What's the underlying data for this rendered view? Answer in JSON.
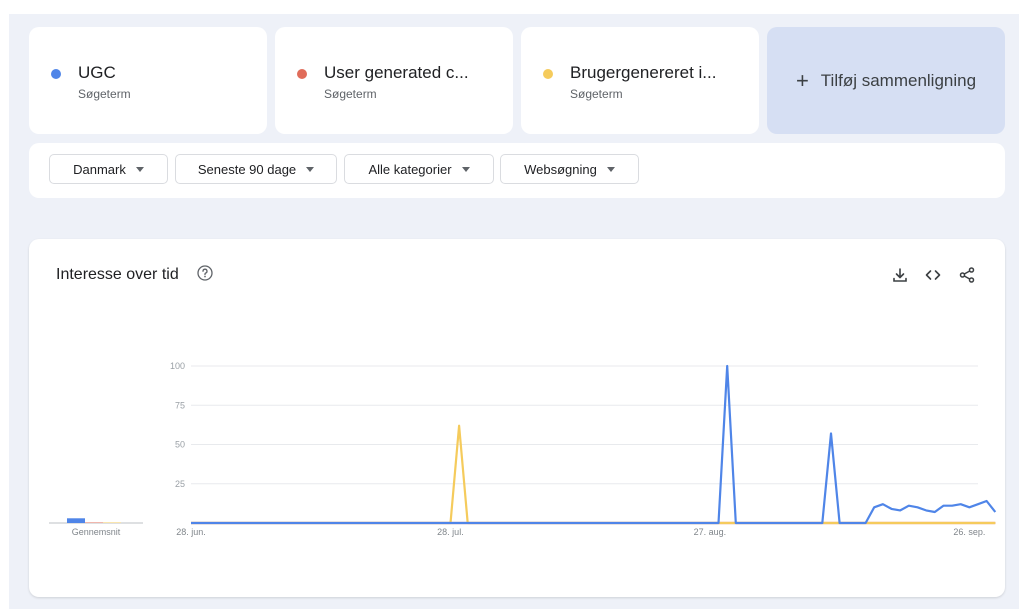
{
  "terms": [
    {
      "name": "UGC",
      "type": "Søgeterm",
      "color": "#4f85e8"
    },
    {
      "name": "User generated c...",
      "type": "Søgeterm",
      "color": "#e06c5a"
    },
    {
      "name": "Brugergenereret i...",
      "type": "Søgeterm",
      "color": "#f5cb5c"
    }
  ],
  "add_compare": {
    "label": "Tilføj sammenligning",
    "icon": "plus-icon"
  },
  "filters": [
    {
      "label": "Danmark"
    },
    {
      "label": "Seneste 90 dage"
    },
    {
      "label": "Alle kategorier"
    },
    {
      "label": "Websøgning"
    }
  ],
  "chart_card": {
    "title": "Interesse over tid",
    "icons": [
      "help-icon",
      "download-icon",
      "embed-icon",
      "share-icon"
    ]
  },
  "chart_data": {
    "type": "line",
    "title": "Interesse over tid",
    "xlabel": "",
    "ylabel": "",
    "ylim": [
      0,
      100
    ],
    "yticks": [
      25,
      50,
      75,
      100
    ],
    "x_tick_labels": [
      {
        "index": 0,
        "label": "28. jun."
      },
      {
        "index": 30,
        "label": "28. jul."
      },
      {
        "index": 60,
        "label": "27. aug."
      },
      {
        "index": 90,
        "label": "26. sep."
      }
    ],
    "num_points": 92,
    "series": [
      {
        "name": "UGC",
        "color": "#4f85e8",
        "average": 3,
        "values": [
          0,
          0,
          0,
          0,
          0,
          0,
          0,
          0,
          0,
          0,
          0,
          0,
          0,
          0,
          0,
          0,
          0,
          0,
          0,
          0,
          0,
          0,
          0,
          0,
          0,
          0,
          0,
          0,
          0,
          0,
          0,
          0,
          0,
          0,
          0,
          0,
          0,
          0,
          0,
          0,
          0,
          0,
          0,
          0,
          0,
          0,
          0,
          0,
          0,
          0,
          0,
          0,
          0,
          0,
          0,
          0,
          0,
          0,
          0,
          0,
          0,
          0,
          100,
          0,
          0,
          0,
          0,
          0,
          0,
          0,
          0,
          0,
          0,
          0,
          57,
          0,
          0,
          0,
          0,
          10,
          12,
          9,
          8,
          11,
          10,
          8,
          7,
          11,
          11,
          12,
          10,
          12,
          14,
          7
        ]
      },
      {
        "name": "User generated c...",
        "color": "#e06c5a",
        "average": 0,
        "values": [
          0,
          0,
          0,
          0,
          0,
          0,
          0,
          0,
          0,
          0,
          0,
          0,
          0,
          0,
          0,
          0,
          0,
          0,
          0,
          0,
          0,
          0,
          0,
          0,
          0,
          0,
          0,
          0,
          0,
          0,
          0,
          0,
          0,
          0,
          0,
          0,
          0,
          0,
          0,
          0,
          0,
          0,
          0,
          0,
          0,
          0,
          0,
          0,
          0,
          0,
          0,
          0,
          0,
          0,
          0,
          0,
          0,
          0,
          0,
          0,
          0,
          0,
          0,
          0,
          0,
          0,
          0,
          0,
          0,
          0,
          0,
          0,
          0,
          0,
          0,
          0,
          0,
          0,
          0,
          0,
          0,
          0,
          0,
          0,
          0,
          0,
          0,
          0,
          0,
          0,
          0,
          0,
          0,
          0
        ]
      },
      {
        "name": "Brugergenereret i...",
        "color": "#f5cb5c",
        "average": 0,
        "values": [
          0,
          0,
          0,
          0,
          0,
          0,
          0,
          0,
          0,
          0,
          0,
          0,
          0,
          0,
          0,
          0,
          0,
          0,
          0,
          0,
          0,
          0,
          0,
          0,
          0,
          0,
          0,
          0,
          0,
          0,
          0,
          62,
          0,
          0,
          0,
          0,
          0,
          0,
          0,
          0,
          0,
          0,
          0,
          0,
          0,
          0,
          0,
          0,
          0,
          0,
          0,
          0,
          0,
          0,
          0,
          0,
          0,
          0,
          0,
          0,
          0,
          0,
          0,
          0,
          0,
          0,
          0,
          0,
          0,
          0,
          0,
          0,
          0,
          0,
          0,
          0,
          0,
          0,
          0,
          0,
          0,
          0,
          0,
          0,
          0,
          0,
          0,
          0,
          0,
          0,
          0,
          0,
          0,
          0
        ]
      }
    ],
    "average_label": "Gennemsnit"
  }
}
